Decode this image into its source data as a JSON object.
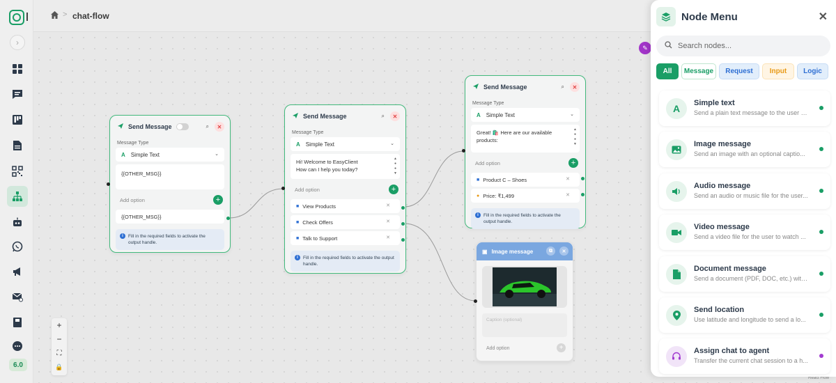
{
  "app": {
    "breadcrumb_separator": ">",
    "flow_title": "chat-flow",
    "version": "6.0"
  },
  "sidebar": {
    "items": [
      {
        "icon": "dashboard-icon"
      },
      {
        "icon": "chat-icon"
      },
      {
        "icon": "kanban-icon"
      },
      {
        "icon": "document-icon"
      },
      {
        "icon": "qr-code-icon"
      },
      {
        "icon": "flow-icon",
        "active": true
      },
      {
        "icon": "bot-icon"
      },
      {
        "icon": "whatsapp-icon"
      },
      {
        "icon": "megaphone-icon"
      },
      {
        "icon": "mail-check-icon"
      },
      {
        "icon": "book-icon"
      },
      {
        "icon": "chat-bubble-icon"
      }
    ]
  },
  "canvas": {
    "node1": {
      "title": "Send Message",
      "type_label": "Message Type",
      "type_value": "Simple Text",
      "message": "{{OTHER_MSG}}",
      "add_option": "Add option",
      "options": [
        "{{OTHER_MSG}}"
      ],
      "notice": "Fill in the required fields to activate the output handle."
    },
    "node2": {
      "title": "Send Message",
      "type_label": "Message Type",
      "type_value": "Simple Text",
      "message_line1": "Hi! Welcome to EasyClient",
      "message_line2": "How can I help you today?",
      "add_option": "Add option",
      "options": [
        "View Products",
        "Check Offers",
        "Talk to Support"
      ],
      "notice": "Fill in the required fields to activate the output handle."
    },
    "node3": {
      "title": "Send Message",
      "type_label": "Message Type",
      "type_value": "Simple Text",
      "message_line1": "Great! 🛍️ Here are our available",
      "message_line2": "products:",
      "add_option": "Add option",
      "options": [
        "Product C – Shoes",
        "Price: ₹1,499"
      ],
      "notice": "Fill in the required fields to activate the output handle."
    },
    "image_node": {
      "title": "Image message",
      "caption_placeholder": "Caption (optional)",
      "add_option": "Add option"
    },
    "attribution": "React Flow"
  },
  "zoom_controls": [
    "+",
    "−",
    "⛶",
    "🔒"
  ],
  "node_menu": {
    "title": "Node Menu",
    "close": "✕",
    "search_placeholder": "Search nodes...",
    "filters": [
      "All",
      "Message",
      "Request",
      "Input",
      "Logic"
    ],
    "active_filter": "All",
    "items": [
      {
        "title": "Simple text",
        "desc": "Send a plain text message to the user a...",
        "icon": "letter-a-icon"
      },
      {
        "title": "Image message",
        "desc": "Send an image with an optional captio...",
        "icon": "image-icon"
      },
      {
        "title": "Audio message",
        "desc": "Send an audio or music file for the user...",
        "icon": "speaker-icon"
      },
      {
        "title": "Video message",
        "desc": "Send a video file for the user to watch ...",
        "icon": "video-camera-icon"
      },
      {
        "title": "Document message",
        "desc": "Send a document (PDF, DOC, etc.) with ...",
        "icon": "file-icon"
      },
      {
        "title": "Send location",
        "desc": "Use latitude and longitude to send a lo...",
        "icon": "map-pin-icon"
      },
      {
        "title": "Assign chat to agent",
        "desc": "Transfer the current chat session to a h...",
        "icon": "headset-icon"
      }
    ]
  },
  "colors": {
    "primary": "#1a9e66",
    "request": "#2e6fd3",
    "input": "#e89a17",
    "agent": "#a23bd0"
  }
}
